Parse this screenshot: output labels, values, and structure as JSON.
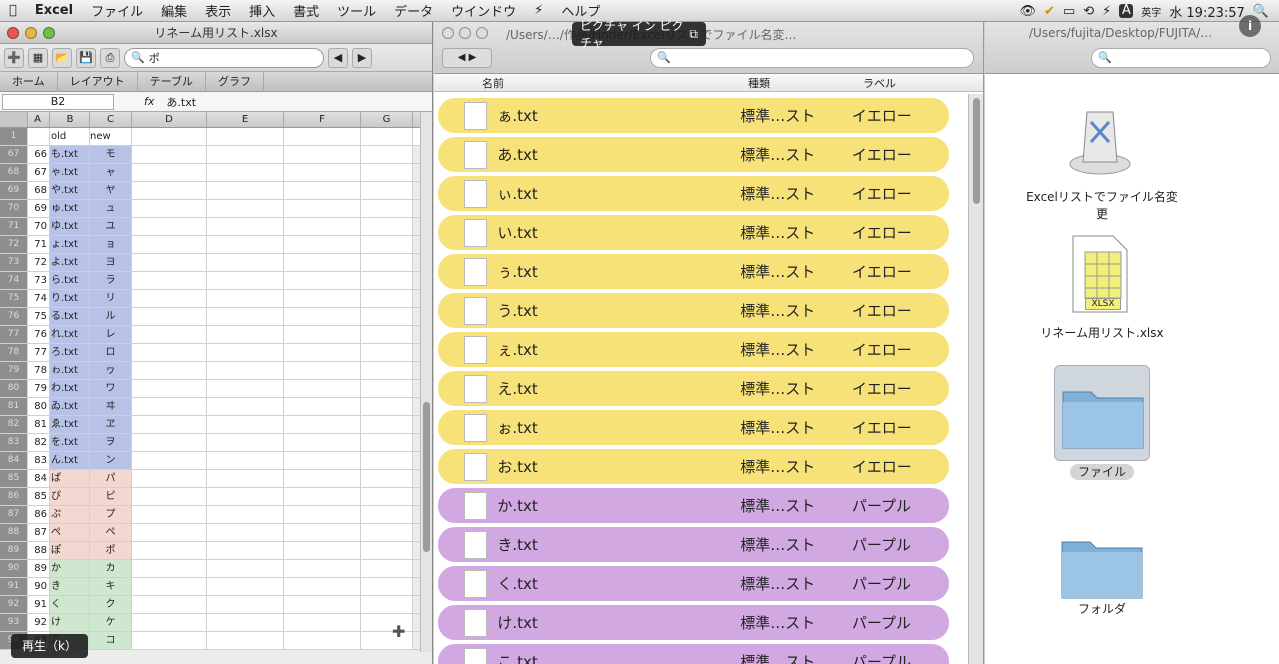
{
  "menubar": {
    "app": "Excel",
    "items": [
      "ファイル",
      "編集",
      "表示",
      "挿入",
      "書式",
      "ツール",
      "データ",
      "ウインドウ",
      "ヘルプ"
    ],
    "input_lang": "英字",
    "clock": "水 19:23:57"
  },
  "pip_tooltip": "ピクチャ イン ピクチャ",
  "play_button": "再生（k）",
  "excel": {
    "title": "リネーム用リスト.xlsx",
    "search_value": "ポ",
    "ribbon_tabs": [
      "ホーム",
      "レイアウト",
      "テーブル",
      "グラフ"
    ],
    "cell_ref": "B2",
    "formula": "あ.txt",
    "col_headers": [
      "A",
      "B",
      "C",
      "D",
      "E",
      "F",
      "G"
    ],
    "header_row": {
      "n": "1",
      "a": "",
      "b": "old",
      "c": "new"
    },
    "rows": [
      {
        "n": "67",
        "a": "66",
        "b": "も.txt",
        "c": "モ",
        "g": "blue"
      },
      {
        "n": "68",
        "a": "67",
        "b": "ゃ.txt",
        "c": "ャ",
        "g": "blue"
      },
      {
        "n": "69",
        "a": "68",
        "b": "や.txt",
        "c": "ヤ",
        "g": "blue"
      },
      {
        "n": "70",
        "a": "69",
        "b": "ゅ.txt",
        "c": "ュ",
        "g": "blue"
      },
      {
        "n": "71",
        "a": "70",
        "b": "ゆ.txt",
        "c": "ユ",
        "g": "blue"
      },
      {
        "n": "72",
        "a": "71",
        "b": "ょ.txt",
        "c": "ョ",
        "g": "blue"
      },
      {
        "n": "73",
        "a": "72",
        "b": "よ.txt",
        "c": "ヨ",
        "g": "blue"
      },
      {
        "n": "74",
        "a": "73",
        "b": "ら.txt",
        "c": "ラ",
        "g": "blue"
      },
      {
        "n": "75",
        "a": "74",
        "b": "り.txt",
        "c": "リ",
        "g": "blue"
      },
      {
        "n": "76",
        "a": "75",
        "b": "る.txt",
        "c": "ル",
        "g": "blue"
      },
      {
        "n": "77",
        "a": "76",
        "b": "れ.txt",
        "c": "レ",
        "g": "blue"
      },
      {
        "n": "78",
        "a": "77",
        "b": "ろ.txt",
        "c": "ロ",
        "g": "blue"
      },
      {
        "n": "79",
        "a": "78",
        "b": "ゎ.txt",
        "c": "ヮ",
        "g": "blue"
      },
      {
        "n": "80",
        "a": "79",
        "b": "わ.txt",
        "c": "ワ",
        "g": "blue"
      },
      {
        "n": "81",
        "a": "80",
        "b": "ゐ.txt",
        "c": "ヰ",
        "g": "blue"
      },
      {
        "n": "82",
        "a": "81",
        "b": "ゑ.txt",
        "c": "ヱ",
        "g": "blue"
      },
      {
        "n": "83",
        "a": "82",
        "b": "を.txt",
        "c": "ヲ",
        "g": "blue"
      },
      {
        "n": "84",
        "a": "83",
        "b": "ん.txt",
        "c": "ン",
        "g": "blue"
      },
      {
        "n": "85",
        "a": "84",
        "b": "ぱ",
        "c": "パ",
        "g": "pink"
      },
      {
        "n": "86",
        "a": "85",
        "b": "ぴ",
        "c": "ピ",
        "g": "pink"
      },
      {
        "n": "87",
        "a": "86",
        "b": "ぷ",
        "c": "プ",
        "g": "pink"
      },
      {
        "n": "88",
        "a": "87",
        "b": "ぺ",
        "c": "ペ",
        "g": "pink"
      },
      {
        "n": "89",
        "a": "88",
        "b": "ぽ",
        "c": "ポ",
        "g": "pink"
      },
      {
        "n": "90",
        "a": "89",
        "b": "か",
        "c": "カ",
        "g": "green"
      },
      {
        "n": "91",
        "a": "90",
        "b": "き",
        "c": "キ",
        "g": "green"
      },
      {
        "n": "92",
        "a": "91",
        "b": "く",
        "c": "ク",
        "g": "green"
      },
      {
        "n": "93",
        "a": "92",
        "b": "け",
        "c": "ケ",
        "g": "green"
      },
      {
        "n": "94",
        "a": "93",
        "b": "こ",
        "c": "コ",
        "g": "green"
      }
    ]
  },
  "finder": {
    "path": "/Users/…/作品/Finder/Excelリストでファイル名変…",
    "col_name": "名前",
    "col_kind": "種類",
    "col_label": "ラベル",
    "files": [
      {
        "name": "ぁ.txt",
        "kind": "標準…スト",
        "label": "イエロー",
        "color": "yellow"
      },
      {
        "name": "あ.txt",
        "kind": "標準…スト",
        "label": "イエロー",
        "color": "yellow"
      },
      {
        "name": "ぃ.txt",
        "kind": "標準…スト",
        "label": "イエロー",
        "color": "yellow"
      },
      {
        "name": "い.txt",
        "kind": "標準…スト",
        "label": "イエロー",
        "color": "yellow"
      },
      {
        "name": "ぅ.txt",
        "kind": "標準…スト",
        "label": "イエロー",
        "color": "yellow"
      },
      {
        "name": "う.txt",
        "kind": "標準…スト",
        "label": "イエロー",
        "color": "yellow"
      },
      {
        "name": "ぇ.txt",
        "kind": "標準…スト",
        "label": "イエロー",
        "color": "yellow"
      },
      {
        "name": "え.txt",
        "kind": "標準…スト",
        "label": "イエロー",
        "color": "yellow"
      },
      {
        "name": "ぉ.txt",
        "kind": "標準…スト",
        "label": "イエロー",
        "color": "yellow"
      },
      {
        "name": "お.txt",
        "kind": "標準…スト",
        "label": "イエロー",
        "color": "yellow"
      },
      {
        "name": "か.txt",
        "kind": "標準…スト",
        "label": "パープル",
        "color": "purple"
      },
      {
        "name": "き.txt",
        "kind": "標準…スト",
        "label": "パープル",
        "color": "purple"
      },
      {
        "name": "く.txt",
        "kind": "標準…スト",
        "label": "パープル",
        "color": "purple"
      },
      {
        "name": "け.txt",
        "kind": "標準…スト",
        "label": "パープル",
        "color": "purple"
      },
      {
        "name": "こ.txt",
        "kind": "標準…スト",
        "label": "パープル",
        "color": "purple"
      }
    ]
  },
  "finder2": {
    "path": "/Users/fujita/Desktop/FUJITA/…",
    "items": [
      "Excelリストでファイル名変更",
      "リネーム用リスト.xlsx",
      "ファイル",
      "フォルダ"
    ],
    "xlsx_badge": "XLSX"
  },
  "colors": {
    "yellow": "#f7e27a",
    "purple": "#d2a8e2",
    "blue_cell": "#b7c2e6",
    "pink_cell": "#f2d8d0",
    "green_cell": "#cfe6cf"
  }
}
